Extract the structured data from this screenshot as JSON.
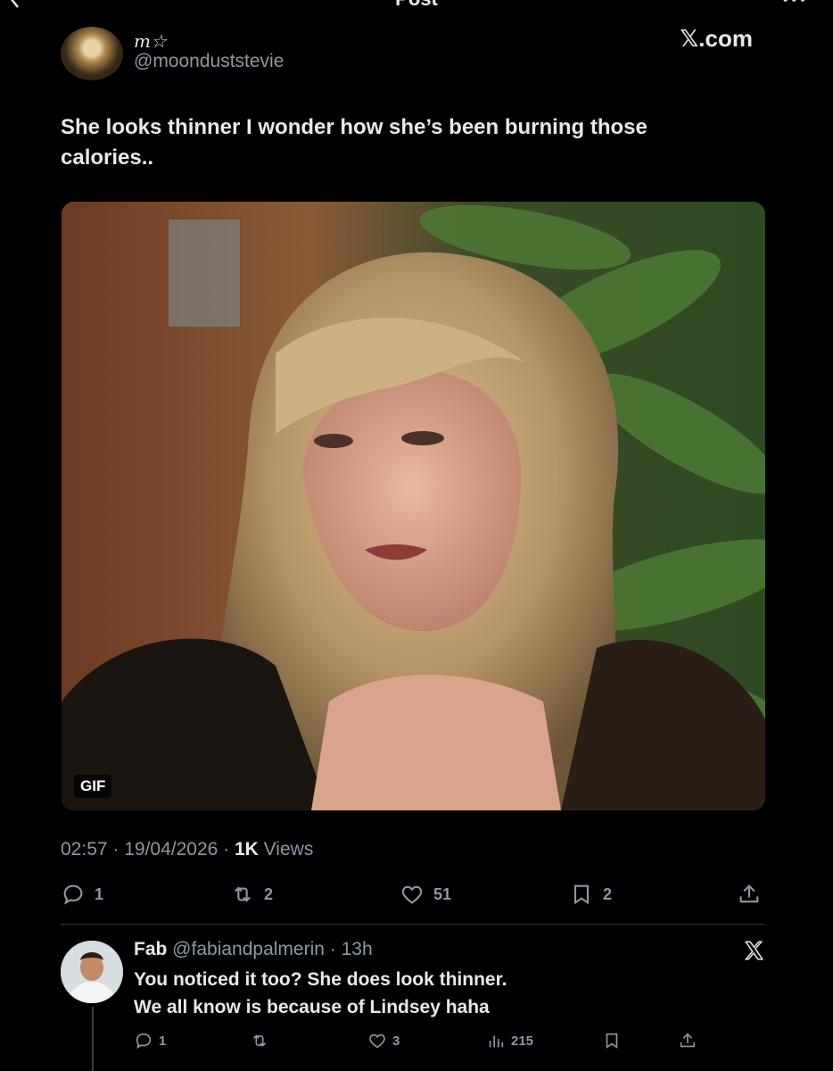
{
  "topbar": {
    "title": "Post"
  },
  "post": {
    "author_name": "m☆",
    "author_handle": "@moondust​stevie",
    "brand": "𝕏.com",
    "text": "She looks thinner I wonder how she’s been burning those calories..",
    "media_badge": "GIF",
    "timestamp": "02:57 · 19/04/2026 · ",
    "views_count": "1K",
    "views_label": " Views",
    "stats": {
      "replies": "1",
      "reposts": "2",
      "likes": "51",
      "bookmarks": "2"
    }
  },
  "reply": {
    "name": "Fab",
    "handle_time": " @fabiandpalmerin · 13h",
    "line1": "You noticed it too? She does look thinner.",
    "line2": "We all know is because of Lindsey haha",
    "stats": {
      "replies": "1",
      "likes": "3",
      "views": "215"
    }
  },
  "colors": {
    "background": "#000000",
    "text": "#e7e9ea",
    "muted": "#8b98a5",
    "divider": "#2f3336"
  }
}
